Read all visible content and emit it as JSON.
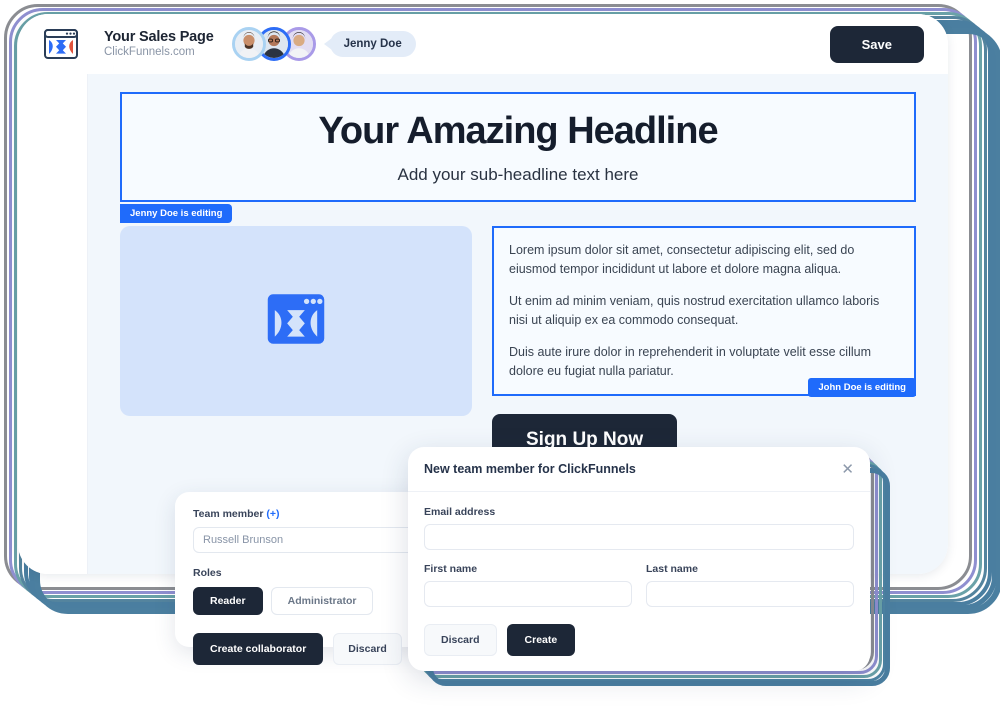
{
  "header": {
    "logo_icon": "clickfunnels-logo-icon",
    "page_title": "Your Sales Page",
    "page_domain": "ClickFunnels.com",
    "collaborators": [
      {
        "name": "Collaborator 1",
        "ring_color": "#a9d2f2"
      },
      {
        "name": "Collaborator 2",
        "ring_color": "#2d6df6"
      },
      {
        "name": "Collaborator 3",
        "ring_color": "#a99ae8"
      }
    ],
    "active_user_label": "Jenny Doe",
    "save_label": "Save"
  },
  "canvas": {
    "headline_block": {
      "headline": "Your Amazing Headline",
      "subheadline": "Add your sub-headline text here",
      "editing_badge": "Jenny Doe is editing"
    },
    "image_block": {
      "placeholder_icon": "clickfunnels-placeholder-icon"
    },
    "text_block": {
      "paragraphs": [
        "Lorem ipsum dolor sit amet, consectetur adipiscing elit, sed do eiusmod tempor incididunt ut labore et dolore magna aliqua.",
        "Ut enim ad minim veniam, quis nostrud exercitation ullamco laboris nisi ut aliquip ex ea commodo consequat.",
        "Duis aute irure dolor in reprehenderit in voluptate velit esse cillum dolore eu fugiat nulla pariatur."
      ],
      "editing_badge": "John Doe is editing"
    },
    "cta_label": "Sign Up Now"
  },
  "team_card": {
    "label": "Team member",
    "add_symbol": "(+)",
    "member_value": "Russell Brunson",
    "roles_label": "Roles",
    "roles": [
      {
        "label": "Reader",
        "active": true
      },
      {
        "label": "Administrator",
        "active": false
      }
    ],
    "primary_action": "Create collaborator",
    "secondary_action": "Discard"
  },
  "modal": {
    "title": "New team member for ClickFunnels",
    "close_icon": "close-icon",
    "fields": {
      "email_label": "Email address",
      "email_value": "",
      "email_placeholder": "",
      "first_name_label": "First name",
      "first_name_value": "",
      "first_name_placeholder": "",
      "last_name_label": "Last name",
      "last_name_value": "",
      "last_name_placeholder": ""
    },
    "discard_label": "Discard",
    "create_label": "Create"
  },
  "colors": {
    "accent_blue": "#1f6bfb",
    "dark_button": "#1d2737",
    "canvas_bg": "#f2f7fc",
    "image_block_bg": "#d4e3fb",
    "stack_gray": "#8b8d92",
    "stack_purple": "#8f8fd0",
    "stack_teal": "#6aa2a8",
    "stack_blue": "#4a7ea0"
  }
}
